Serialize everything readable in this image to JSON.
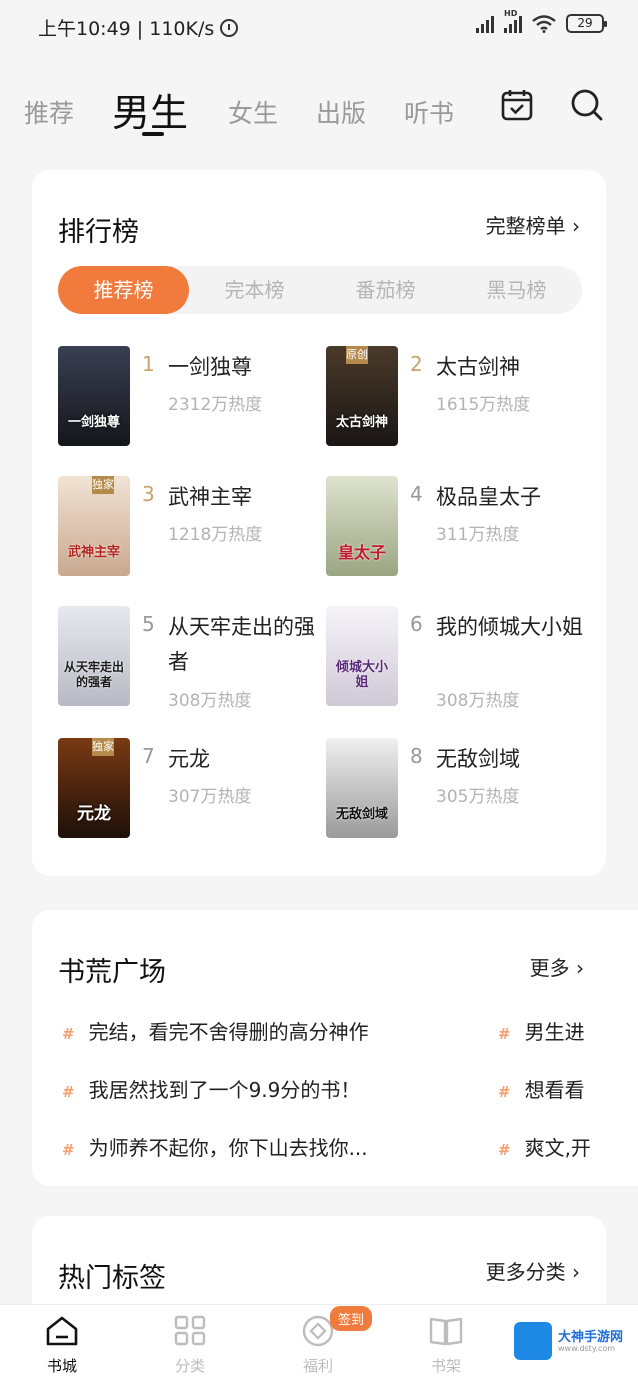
{
  "status": {
    "time_speed": "上午10:49 | 110K/s",
    "battery": "29",
    "network_hd": "HD"
  },
  "tabs": [
    {
      "label": "推荐"
    },
    {
      "label": "男生"
    },
    {
      "label": "女生"
    },
    {
      "label": "出版"
    },
    {
      "label": "听书"
    }
  ],
  "ranking": {
    "title": "排行榜",
    "more": "完整榜单 ›",
    "segments": [
      "推荐榜",
      "完本榜",
      "番茄榜",
      "黑马榜"
    ],
    "books": [
      {
        "rank": "1",
        "name": "一剑独尊",
        "heat": "2312万热度",
        "cover_text": "一剑独尊",
        "cover_tag": "",
        "cover_color": "#1b1c22"
      },
      {
        "rank": "2",
        "name": "太古剑神",
        "heat": "1615万热度",
        "cover_text": "太古剑神",
        "cover_tag": "原创",
        "cover_color": "#2a2420"
      },
      {
        "rank": "3",
        "name": "武神主宰",
        "heat": "1218万热度",
        "cover_text": "武神主宰",
        "cover_tag": "独家",
        "cover_color": "#e8d6c7"
      },
      {
        "rank": "4",
        "name": "极品皇太子",
        "heat": "311万热度",
        "cover_text": "皇太子",
        "cover_tag": "",
        "cover_color": "#c8cfb8"
      },
      {
        "rank": "5",
        "name": "从天牢走出的强者",
        "heat": "308万热度",
        "cover_text": "从天牢走出的强者",
        "cover_tag": "",
        "cover_color": "#d9d9de"
      },
      {
        "rank": "6",
        "name": "我的倾城大小姐",
        "heat": "308万热度",
        "cover_text": "倾城大小姐",
        "cover_tag": "",
        "cover_color": "#eceaf0"
      },
      {
        "rank": "7",
        "name": "元龙",
        "heat": "307万热度",
        "cover_text": "元龙",
        "cover_tag": "独家",
        "cover_color": "#3a1f10"
      },
      {
        "rank": "8",
        "name": "无敌剑域",
        "heat": "305万热度",
        "cover_text": "无敌剑域",
        "cover_tag": "",
        "cover_color": "#d6d6d6"
      }
    ]
  },
  "plaza": {
    "title": "书荒广场",
    "more": "更多 ›",
    "topics": [
      {
        "main": "完结，看完不舍得删的高分神作",
        "side": "男生进"
      },
      {
        "main": "我居然找到了一个9.9分的书！",
        "side": "想看看"
      },
      {
        "main": "为师养不起你，你下山去找你...",
        "side": "爽文,开"
      }
    ],
    "hash": "#"
  },
  "tags_section": {
    "title": "热门标签",
    "more": "更多分类 ›"
  },
  "bottom_nav": [
    {
      "label": "书城"
    },
    {
      "label": "分类"
    },
    {
      "label": "福利"
    },
    {
      "label": "书架"
    }
  ],
  "badge": "签到",
  "watermark": {
    "title": "大神手游网",
    "sub": "www.dsty.com"
  },
  "colors": {
    "accent": "#f07b3c",
    "heat": "#b3b3b3",
    "rank_top": "#c9a36a"
  }
}
